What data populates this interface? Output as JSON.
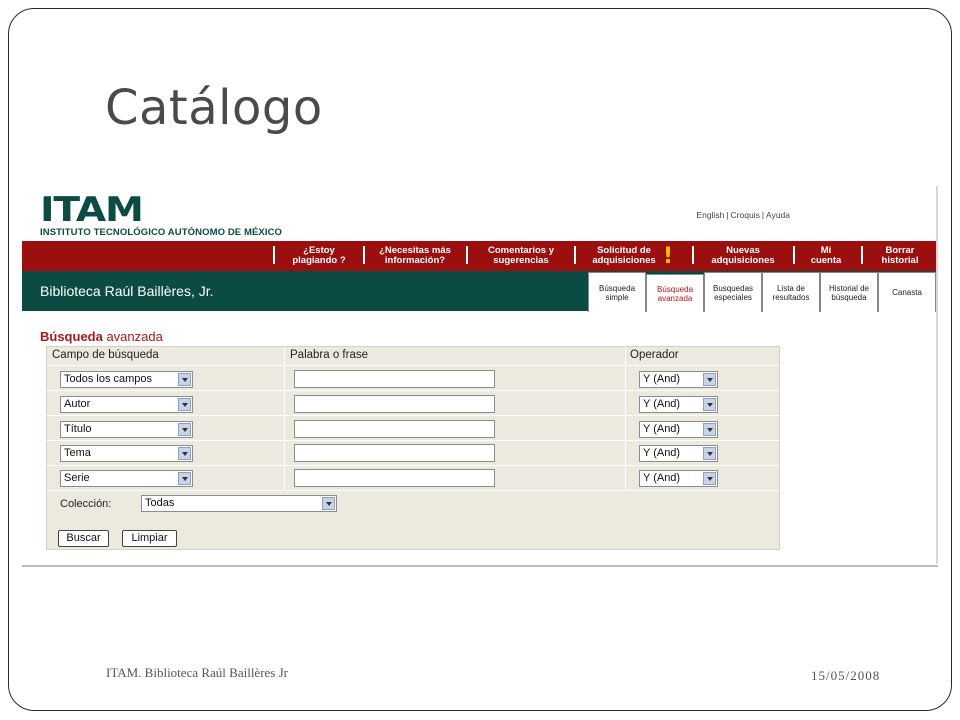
{
  "slide": {
    "title": "Catálogo",
    "footer_left": "ITAM. Biblioteca Raúl Baillères Jr",
    "footer_right": "15/05/2008"
  },
  "site": {
    "logo_text": "ITAM",
    "institution": "INSTITUTO TECNOLÓGICO AUTÓNOMO DE MÉXICO",
    "top_links": [
      "English",
      "Croquis",
      "Ayuda"
    ],
    "library_name": "Biblioteca Raúl Baillères, Jr."
  },
  "colors": {
    "red_bar": "#9c0f0f",
    "green_bar": "#0c4b43",
    "accent_red": "#a81a1a",
    "form_bg": "#ece9df"
  },
  "nav": [
    {
      "line1": "¿Estoy",
      "line2": "plagiando ?"
    },
    {
      "line1": "¿Necesitas más",
      "line2": "información?"
    },
    {
      "line1": "Comentarios y",
      "line2": "sugerencias"
    },
    {
      "line1": "Solicitud de",
      "line2": "adquisiciones"
    },
    {
      "line1": "Nuevas",
      "line2": "adquisiciones"
    },
    {
      "line1": "Mi",
      "line2": "cuenta"
    },
    {
      "line1": "Borrar",
      "line2": "historial"
    }
  ],
  "tabs": [
    {
      "line1": "Búsqueda",
      "line2": "simple",
      "active": false
    },
    {
      "line1": "Búsqueda",
      "line2": "avanzada",
      "active": true
    },
    {
      "line1": "Busquedas",
      "line2": "especiales",
      "active": false
    },
    {
      "line1": "Lista de",
      "line2": "resultados",
      "active": false
    },
    {
      "line1": "Historial de",
      "line2": "búsqueda",
      "active": false
    },
    {
      "line1": "Canasta",
      "line2": "",
      "active": false
    }
  ],
  "search": {
    "heading_bold": "Búsqueda",
    "heading_rest": " avanzada",
    "headers": {
      "field": "Campo de búsqueda",
      "term": "Palabra o frase",
      "operator": "Operador"
    },
    "rows": [
      {
        "field": "Todos los campos",
        "term": "",
        "operator": "Y (And)"
      },
      {
        "field": "Autor",
        "term": "",
        "operator": "Y (And)"
      },
      {
        "field": "Título",
        "term": "",
        "operator": "Y (And)"
      },
      {
        "field": "Tema",
        "term": "",
        "operator": "Y (And)"
      },
      {
        "field": "Serie",
        "term": "",
        "operator": "Y (And)"
      }
    ],
    "collection_label": "Colección:",
    "collection_value": "Todas",
    "search_button": "Buscar",
    "clear_button": "Limpiar"
  }
}
